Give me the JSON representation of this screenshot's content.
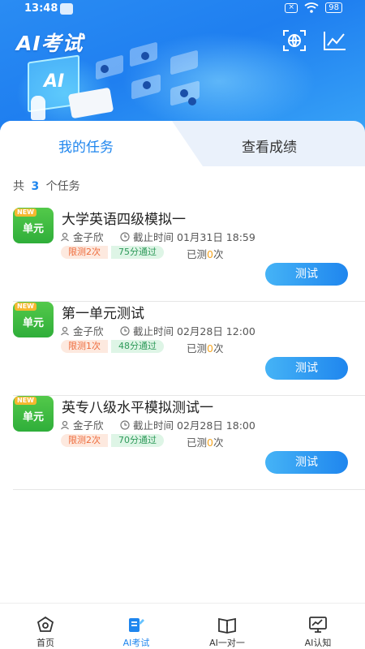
{
  "status_bar": {
    "time": "13:48",
    "battery": "98"
  },
  "header": {
    "title": "AI考试",
    "icons": [
      "scan-globe-icon",
      "chart-trend-icon"
    ]
  },
  "tabs": [
    {
      "label": "我的任务",
      "active": true
    },
    {
      "label": "查看成绩",
      "active": false
    }
  ],
  "task_count": {
    "prefix": "共",
    "count": "3",
    "suffix": "个任务"
  },
  "tasks": [
    {
      "badge_new": "NEW",
      "badge_type": "单元",
      "title": "大学英语四级模拟一",
      "teacher": "金子欣",
      "deadline_label": "截止时间",
      "deadline": "01月31日 18:59",
      "limit": "限测2次",
      "pass": "75分通过",
      "tested_prefix": "已测",
      "tested_count": "0",
      "tested_suffix": "次",
      "button": "测试"
    },
    {
      "badge_new": "NEW",
      "badge_type": "单元",
      "title": "第一单元测试",
      "teacher": "金子欣",
      "deadline_label": "截止时间",
      "deadline": "02月28日 12:00",
      "limit": "限测1次",
      "pass": "48分通过",
      "tested_prefix": "已测",
      "tested_count": "0",
      "tested_suffix": "次",
      "button": "测试"
    },
    {
      "badge_new": "NEW",
      "badge_type": "单元",
      "title": "英专八级水平模拟测试一",
      "teacher": "金子欣",
      "deadline_label": "截止时间",
      "deadline": "02月28日 18:00",
      "limit": "限测2次",
      "pass": "70分通过",
      "tested_prefix": "已测",
      "tested_count": "0",
      "tested_suffix": "次",
      "button": "测试"
    }
  ],
  "bottom_nav": [
    {
      "label": "首页",
      "icon": "home-icon",
      "active": false
    },
    {
      "label": "AI考试",
      "icon": "exam-icon",
      "active": true
    },
    {
      "label": "AI一对一",
      "icon": "book-icon",
      "active": false
    },
    {
      "label": "AI认知",
      "icon": "monitor-chart-icon",
      "active": false
    }
  ],
  "colors": {
    "primary": "#1f86ee",
    "green_badge": "#2fae3a",
    "orange": "#ee6b3b",
    "tab_bg": "#eaf1fb"
  }
}
